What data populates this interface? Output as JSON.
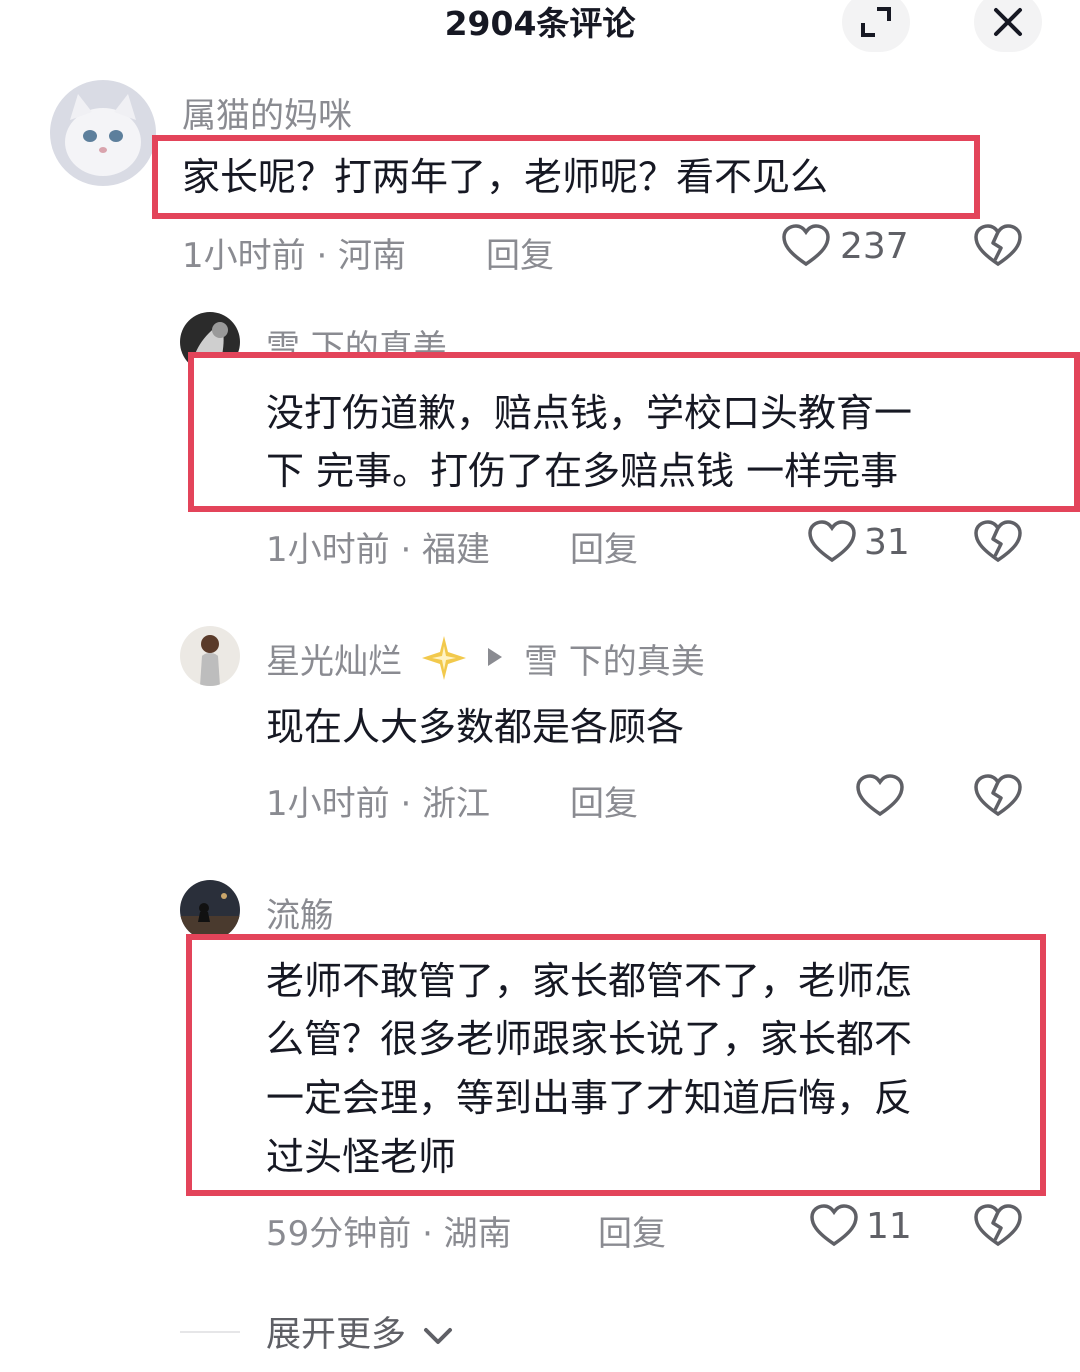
{
  "header": {
    "title": "2904条评论"
  },
  "comments": [
    {
      "username": "属猫的妈咪",
      "text": "家长呢？打两年了，老师呢？看不见么",
      "time_location": "1小时前 · 河南",
      "reply_label": "回复",
      "likes": "237"
    },
    {
      "username": "雪  下的真美",
      "text_line1": "没打伤道歉，赔点钱，学校口头教育一",
      "text_line2": "下 完事。打伤了在多赔点钱  一样完事",
      "time_location": "1小时前 · 福建",
      "reply_label": "回复",
      "likes": "31"
    },
    {
      "username": "星光灿烂",
      "reply_to": "雪  下的真美",
      "text": "现在人大多数都是各顾各",
      "time_location": "1小时前 · 浙江",
      "reply_label": "回复",
      "likes": ""
    },
    {
      "username": "流觞",
      "text_line1": "老师不敢管了，家长都管不了，老师怎",
      "text_line2": "么管？很多老师跟家长说了，家长都不",
      "text_line3": "一定会理，等到出事了才知道后悔，反",
      "text_line4": "过头怪老师",
      "time_location": "59分钟前 · 湖南",
      "reply_label": "回复",
      "likes": "11"
    }
  ],
  "footer": {
    "expand_more": "展开更多"
  },
  "colors": {
    "highlight_border": "#e3445a",
    "secondary_text": "#8a8b91",
    "primary_text": "#161823"
  },
  "icons": [
    "expand-icon",
    "close-icon",
    "heart-icon",
    "broken-heart-icon",
    "chevron-down-icon",
    "triangle-right-icon",
    "sparkle-emoji"
  ]
}
